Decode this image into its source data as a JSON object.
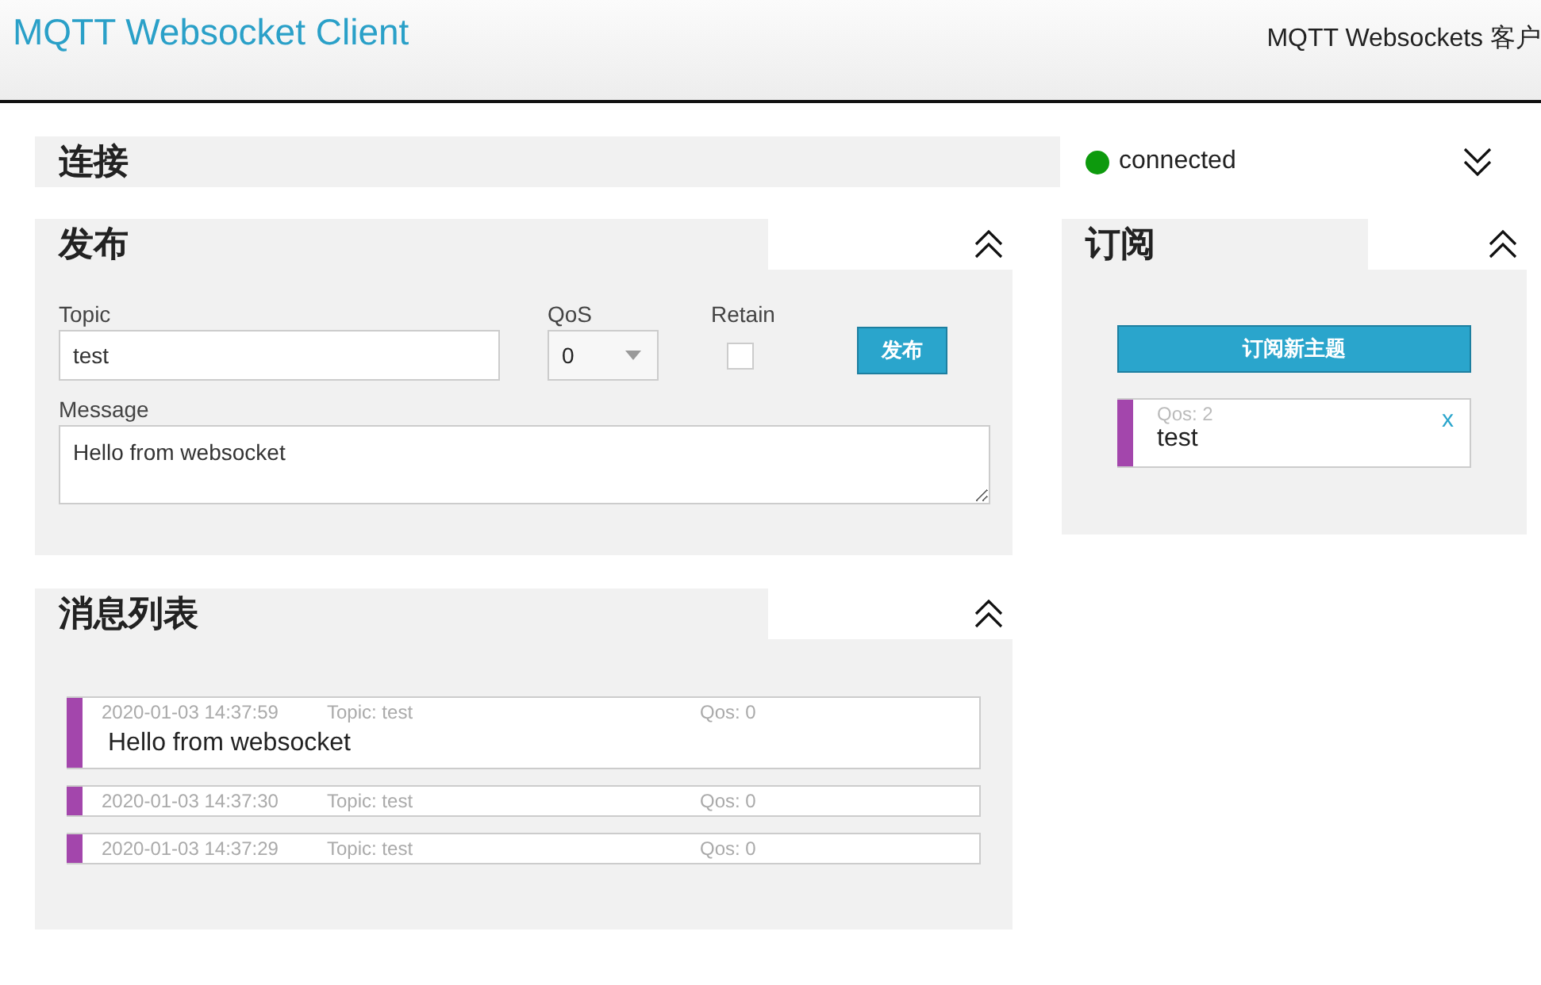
{
  "header": {
    "title": "MQTT Websocket Client",
    "subtitle": "MQTT Websockets 客户"
  },
  "connection": {
    "title": "连接",
    "status": "connected",
    "connected": true,
    "expanded": false
  },
  "publish": {
    "title": "发布",
    "expanded": true,
    "topic_label": "Topic",
    "topic": "test",
    "qos_label": "QoS",
    "qos": "0",
    "retain_label": "Retain",
    "retain": false,
    "button": "发布",
    "message_label": "Message",
    "message": "Hello from websocket"
  },
  "messages": {
    "title": "消息列表",
    "expanded": true,
    "items": [
      {
        "time": "2020-01-03 14:37:59",
        "topic": "Topic: test",
        "qos": "Qos: 0",
        "color": "#a346ac",
        "message": "Hello from websocket"
      },
      {
        "time": "2020-01-03 14:37:30",
        "topic": "Topic: test",
        "qos": "Qos: 0",
        "color": "#a346ac"
      },
      {
        "time": "2020-01-03 14:37:29",
        "topic": "Topic: test",
        "qos": "Qos: 0",
        "color": "#a346ac"
      }
    ]
  },
  "subscribe": {
    "title": "订阅",
    "expanded": true,
    "button": "订阅新主题",
    "items": [
      {
        "qos": "Qos: 2",
        "topic": "test",
        "color": "#a346ac",
        "remove": "x"
      }
    ]
  }
}
